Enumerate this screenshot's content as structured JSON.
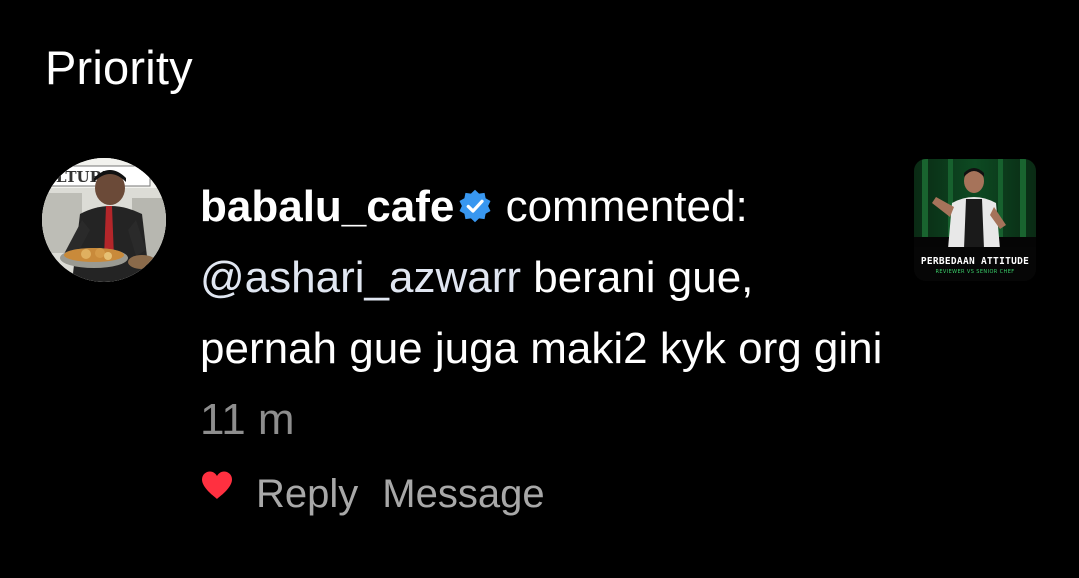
{
  "section": {
    "title": "Priority"
  },
  "notification": {
    "username": "babalu_cafe",
    "verified_icon": "verified-badge-icon",
    "action": "commented:",
    "mention": "@ashari_azwarr",
    "comment": "berani gue, pernah gue juga maki2 kyk org gini",
    "timestamp": "11 m",
    "liked": true,
    "reply_label": "Reply",
    "message_label": "Message",
    "avatar_sign_text": "LTURE",
    "thumbnail": {
      "title": "PERBEDAAN ATTITUDE",
      "subtitle": "REVIEWER VS SENIOR CHEF"
    }
  },
  "colors": {
    "background": "#000000",
    "text": "#ffffff",
    "secondary_text": "#8e8e8e",
    "action_text": "#a8a8a8",
    "heart": "#ff3040",
    "verified": "#3897f0"
  }
}
